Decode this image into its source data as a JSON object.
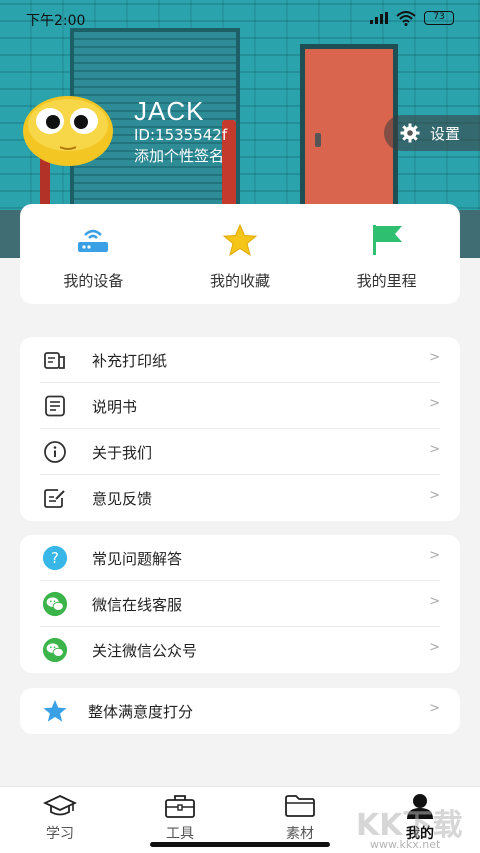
{
  "status": {
    "time": "下午2:00",
    "battery": "73"
  },
  "profile": {
    "name": "JACK",
    "id": "ID:1535542f",
    "signature": "添加个性签名",
    "settings_label": "设置"
  },
  "quick": [
    {
      "label": "我的设备",
      "icon": "router-icon"
    },
    {
      "label": "我的收藏",
      "icon": "star-icon"
    },
    {
      "label": "我的里程",
      "icon": "flag-icon"
    }
  ],
  "group1": [
    {
      "label": "补充打印纸",
      "icon": "printer-paper-icon"
    },
    {
      "label": "说明书",
      "icon": "manual-icon"
    },
    {
      "label": "关于我们",
      "icon": "info-icon"
    },
    {
      "label": "意见反馈",
      "icon": "feedback-icon"
    }
  ],
  "group2": [
    {
      "label": "常见问题解答",
      "icon": "question-icon"
    },
    {
      "label": "微信在线客服",
      "icon": "wechat-icon"
    },
    {
      "label": "关注微信公众号",
      "icon": "wechat-icon"
    }
  ],
  "group3": [
    {
      "label": "整体满意度打分",
      "icon": "star-icon"
    }
  ],
  "chevron": ">",
  "tabs": [
    {
      "label": "学习",
      "icon": "graduation-cap-icon"
    },
    {
      "label": "工具",
      "icon": "toolbox-icon"
    },
    {
      "label": "素材",
      "icon": "folder-icon"
    },
    {
      "label": "我的",
      "icon": "person-icon",
      "active": true
    }
  ],
  "watermark": {
    "big": "KK下载",
    "small": "www.kkx.net"
  },
  "colors": {
    "accent_blue": "#3aa0e6",
    "star_yellow": "#f5c518",
    "flag_green": "#2fbf71",
    "wechat_green": "#3bb54a",
    "question_blue": "#38b6e8"
  }
}
